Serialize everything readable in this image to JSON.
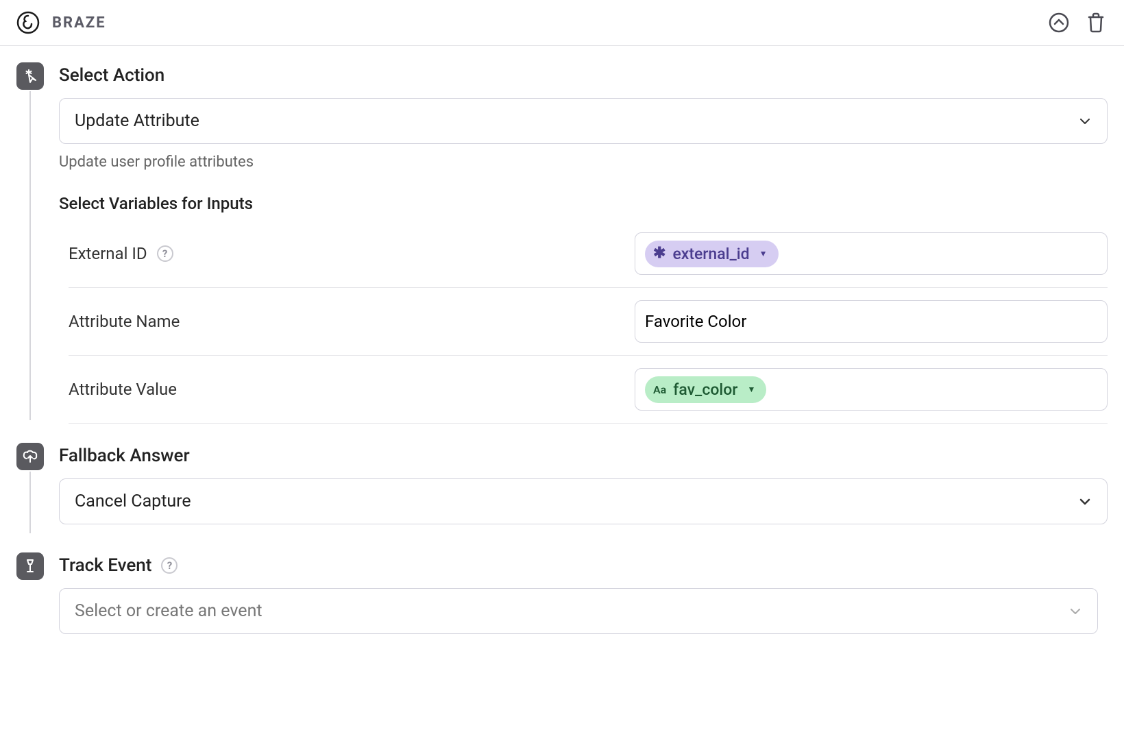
{
  "header": {
    "brand": "BRAZE"
  },
  "action": {
    "title": "Select Action",
    "value": "Update Attribute",
    "hint": "Update user profile attributes"
  },
  "variables": {
    "title": "Select Variables for Inputs",
    "rows": {
      "external_id": {
        "label": "External ID",
        "chip_text": "external_id"
      },
      "attr_name": {
        "label": "Attribute Name",
        "value": "Favorite Color"
      },
      "attr_value": {
        "label": "Attribute Value",
        "chip_text": "fav_color"
      }
    }
  },
  "fallback": {
    "title": "Fallback Answer",
    "value": "Cancel Capture"
  },
  "track": {
    "title": "Track Event",
    "placeholder": "Select or create an event"
  }
}
